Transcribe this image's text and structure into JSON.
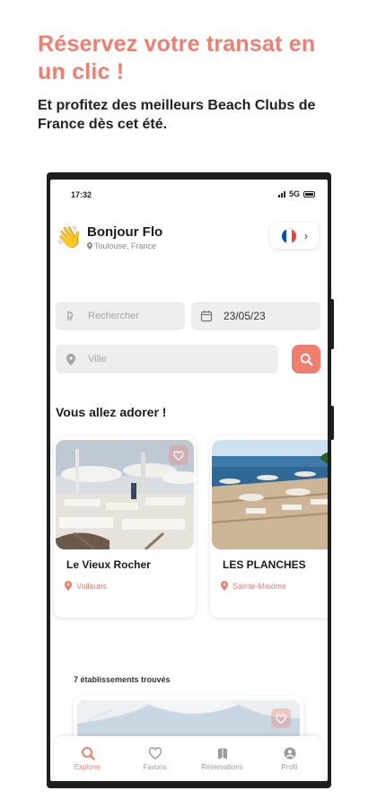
{
  "promo": {
    "title": "Réservez votre transat en un clic !",
    "subtitle": "Et profitez des meilleurs Beach Clubs de France dès cet été."
  },
  "status_bar": {
    "time": "17:32",
    "network": "5G"
  },
  "header": {
    "greeting": "Bonjour Flo",
    "location": "Toulouse, France",
    "wave_emoji": "👋"
  },
  "language": {
    "flag_colors": [
      "#0055a4",
      "#ffffff",
      "#ef4135"
    ]
  },
  "search": {
    "search_placeholder": "Rechercher",
    "date_value": "23/05/23",
    "city_placeholder": "Ville"
  },
  "featured": {
    "title": "Vous allez adorer !",
    "cards": [
      {
        "name": "Le Vieux Rocher",
        "location": "Vallauris"
      },
      {
        "name": "LES PLANCHES",
        "location": "Sainte-Maxime"
      }
    ]
  },
  "results": {
    "count_label": "7 établissements trouvés"
  },
  "tabbar": {
    "tabs": [
      {
        "label": "Explorer",
        "icon": "search-icon",
        "active": true
      },
      {
        "label": "Favoris",
        "icon": "heart-icon",
        "active": false
      },
      {
        "label": "Réservations",
        "icon": "book-icon",
        "active": false
      },
      {
        "label": "Profil",
        "icon": "user-icon",
        "active": false
      }
    ]
  },
  "colors": {
    "accent": "#f07e6e",
    "field_bg": "#eeeeee",
    "phone_frame": "#1e1e1e"
  }
}
